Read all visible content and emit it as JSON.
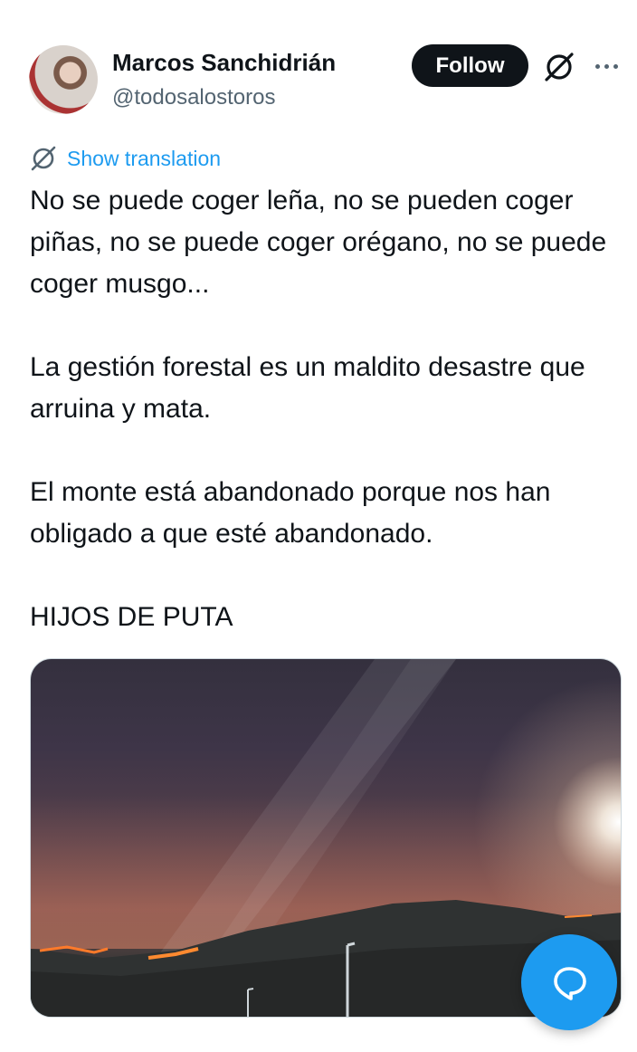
{
  "author": {
    "name": "Marcos Sanchidrián",
    "handle": "@todosalostoros"
  },
  "actions": {
    "follow_label": "Follow"
  },
  "translation": {
    "label": "Show translation"
  },
  "tweet": {
    "paragraphs": [
      "No se puede coger leña, no se pueden coger piñas, no se puede coger orégano, no se puede coger musgo...",
      "La gestión forestal es un maldito desastre que arruina y mata.",
      "El monte está abandonado porque nos han obligado a que esté abandonado.",
      "HIJOS DE PUTA"
    ]
  },
  "icons": {
    "grok": "grok-icon",
    "more": "more-icon",
    "translate": "translate-icon",
    "compose_reply": "chat-bubble-icon"
  },
  "colors": {
    "accent": "#1d9bf0",
    "follow_bg": "#0f1419",
    "secondary_text": "#536471"
  }
}
